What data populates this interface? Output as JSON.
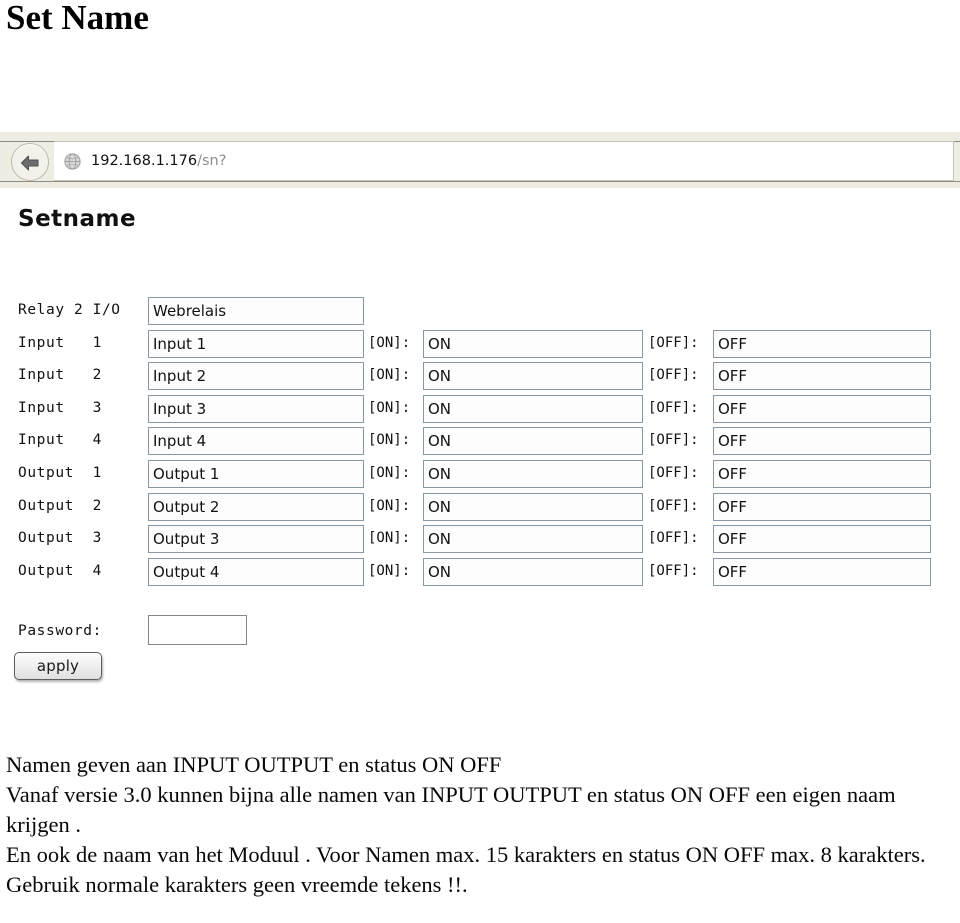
{
  "page_title": "Set Name",
  "browser": {
    "back_icon": "back-arrow-icon",
    "site_icon": "globe-icon",
    "url_host": "192.168.1.176",
    "url_path": "/sn?"
  },
  "form": {
    "heading": "Setname",
    "rows": [
      {
        "label": "Relay 2 I/O",
        "name_value": "Webrelais",
        "has_state": false,
        "on_label": "",
        "on_value": "",
        "off_label": "",
        "off_value": ""
      },
      {
        "label": "Input   1",
        "name_value": "Input 1",
        "has_state": true,
        "on_label": "[ON]:",
        "on_value": "ON",
        "off_label": "[OFF]:",
        "off_value": "OFF"
      },
      {
        "label": "Input   2",
        "name_value": "Input 2",
        "has_state": true,
        "on_label": "[ON]:",
        "on_value": "ON",
        "off_label": "[OFF]:",
        "off_value": "OFF"
      },
      {
        "label": "Input   3",
        "name_value": "Input 3",
        "has_state": true,
        "on_label": "[ON]:",
        "on_value": "ON",
        "off_label": "[OFF]:",
        "off_value": "OFF"
      },
      {
        "label": "Input   4",
        "name_value": "Input 4",
        "has_state": true,
        "on_label": "[ON]:",
        "on_value": "ON",
        "off_label": "[OFF]:",
        "off_value": "OFF"
      },
      {
        "label": "Output  1",
        "name_value": "Output 1",
        "has_state": true,
        "on_label": "[ON]:",
        "on_value": "ON",
        "off_label": "[OFF]:",
        "off_value": "OFF"
      },
      {
        "label": "Output  2",
        "name_value": "Output 2",
        "has_state": true,
        "on_label": "[ON]:",
        "on_value": "ON",
        "off_label": "[OFF]:",
        "off_value": "OFF"
      },
      {
        "label": "Output  3",
        "name_value": "Output 3",
        "has_state": true,
        "on_label": "[ON]:",
        "on_value": "ON",
        "off_label": "[OFF]:",
        "off_value": "OFF"
      },
      {
        "label": "Output  4",
        "name_value": "Output 4",
        "has_state": true,
        "on_label": "[ON]:",
        "on_value": "ON",
        "off_label": "[OFF]:",
        "off_value": "OFF"
      }
    ],
    "password_label": "Password:",
    "password_value": "",
    "apply_label": "apply"
  },
  "description": {
    "line1": "Namen geven aan INPUT OUTPUT en status ON OFF",
    "line2": "Vanaf versie 3.0 kunnen bijna alle namen van INPUT OUTPUT en status ON OFF een eigen naam krijgen .",
    "line3": "En ook de naam van het Moduul . Voor Namen max. 15 karakters en status ON OFF max. 8 karakters.",
    "line4": "Gebruik normale karakters geen vreemde tekens !!."
  },
  "colors": {
    "chrome_background": "#efece2",
    "field_border": "#8996a4",
    "url_path_text": "#8d8d8d"
  }
}
